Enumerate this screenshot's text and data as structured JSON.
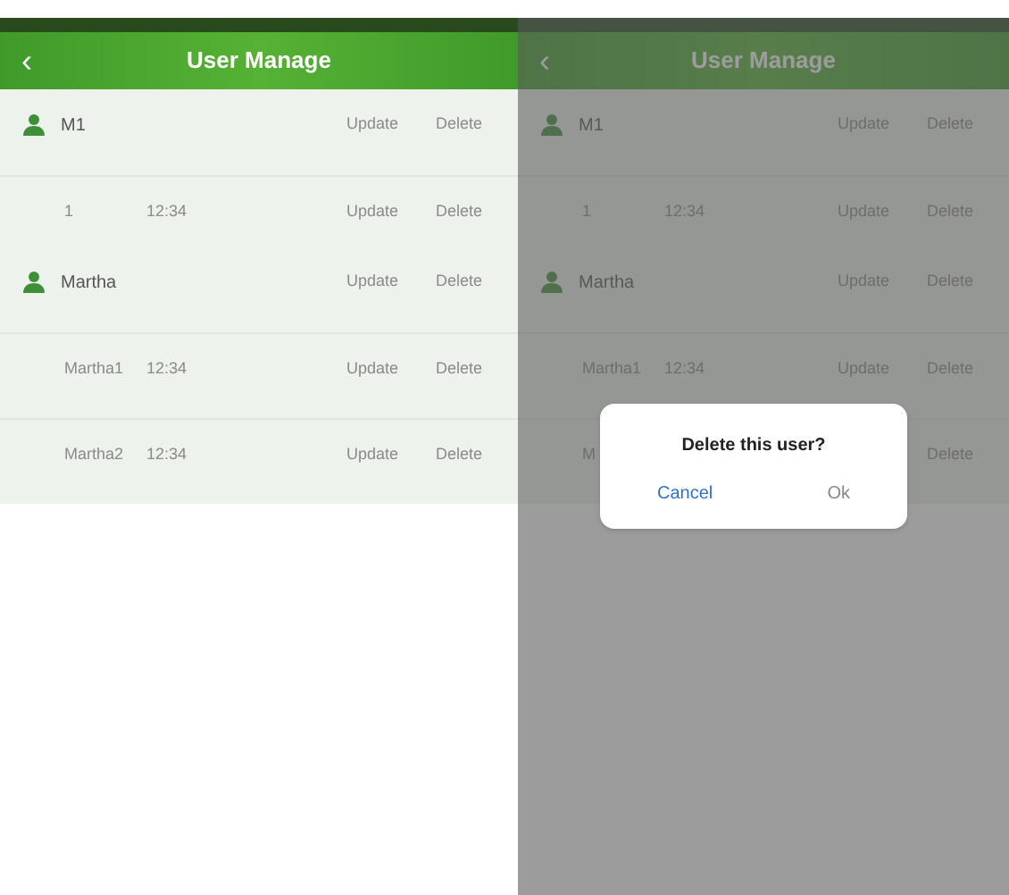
{
  "screens": [
    {
      "title": "User Manage",
      "back": "‹",
      "dimmed": false,
      "rows": [
        {
          "kind": "user",
          "name": "M1",
          "update": "Update",
          "delete": "Delete"
        },
        {
          "kind": "record",
          "name": "1",
          "time": "12:34",
          "update": "Update",
          "delete": "Delete"
        },
        {
          "kind": "user",
          "name": "Martha",
          "update": "Update",
          "delete": "Delete"
        },
        {
          "kind": "record",
          "name": "Martha1",
          "time": "12:34",
          "update": "Update",
          "delete": "Delete"
        },
        {
          "kind": "record",
          "name": "Martha2",
          "time": "12:34",
          "update": "Update",
          "delete": "Delete"
        }
      ]
    },
    {
      "title": "User Manage",
      "back": "‹",
      "dimmed": true,
      "rows": [
        {
          "kind": "user",
          "name": "M1",
          "update": "Update",
          "delete": "Delete"
        },
        {
          "kind": "record",
          "name": "1",
          "time": "12:34",
          "update": "Update",
          "delete": "Delete"
        },
        {
          "kind": "user",
          "name": "Martha",
          "update": "Update",
          "delete": "Delete"
        },
        {
          "kind": "record",
          "name": "Martha1",
          "time": "12:34",
          "update": "Update",
          "delete": "Delete"
        },
        {
          "kind": "record",
          "name": "M",
          "delete": "Delete"
        }
      ],
      "dialog": {
        "message": "Delete this user?",
        "buttons": [
          "Cancel",
          "Ok"
        ]
      }
    }
  ]
}
